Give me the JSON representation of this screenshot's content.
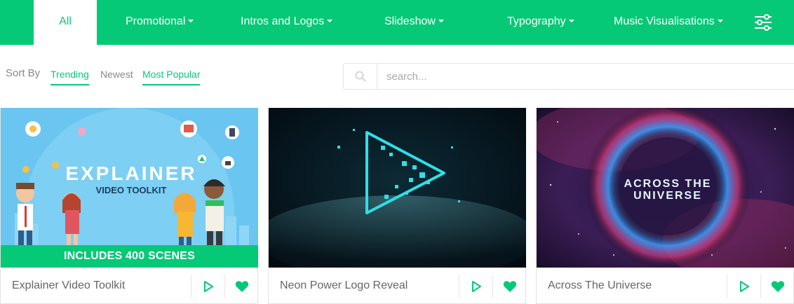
{
  "nav": {
    "items": [
      {
        "label": "All",
        "active": true
      },
      {
        "label": "Promotional",
        "dropdown": true
      },
      {
        "label": "Intros and Logos",
        "dropdown": true
      },
      {
        "label": "Slideshow",
        "dropdown": true
      },
      {
        "label": "Typography",
        "dropdown": true
      },
      {
        "label": "Music Visualisations",
        "dropdown": true
      }
    ],
    "filter_icon": "sliders-icon"
  },
  "sort": {
    "label": "Sort By",
    "options": [
      {
        "label": "Trending",
        "selected": true
      },
      {
        "label": "Newest",
        "selected": false
      },
      {
        "label": "Most Popular",
        "selected": true
      }
    ]
  },
  "search": {
    "placeholder": "search...",
    "value": "",
    "icon": "search-icon"
  },
  "cards": [
    {
      "title": "Explainer Video Toolkit",
      "banner": "INCLUDES 400 SCENES",
      "thumb_text_1": "EXPLAINER",
      "thumb_text_2": "VIDEO TOOLKIT",
      "icons": [
        "play-icon",
        "heart-icon"
      ]
    },
    {
      "title": "Neon Power Logo Reveal",
      "icons": [
        "play-icon",
        "heart-icon"
      ]
    },
    {
      "title": "Across The Universe",
      "thumb_text_1": "ACROSS THE",
      "thumb_text_2": "UNIVERSE",
      "icons": [
        "play-icon",
        "heart-icon"
      ]
    }
  ],
  "colors": {
    "accent": "#06c977",
    "text": "#666666",
    "muted": "#888888"
  }
}
